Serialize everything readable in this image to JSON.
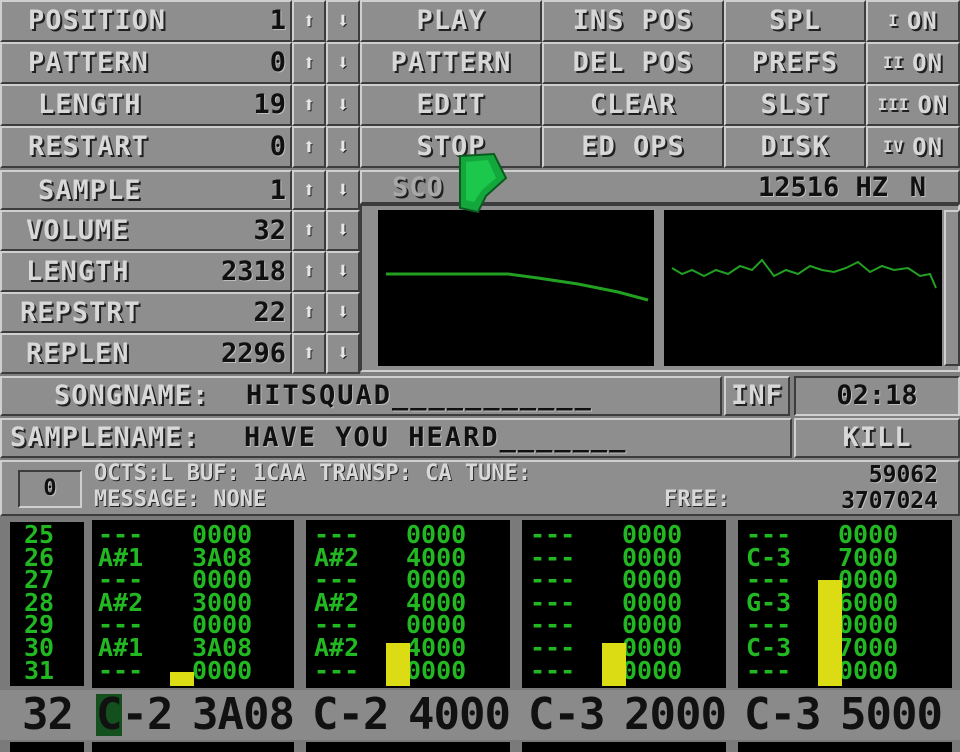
{
  "song_panel": {
    "rows": [
      {
        "label": "POSITION",
        "value": "1"
      },
      {
        "label": "PATTERN",
        "value": "0"
      },
      {
        "label": "LENGTH",
        "value": "19"
      },
      {
        "label": "RESTART",
        "value": "0"
      }
    ]
  },
  "buttons": {
    "play": "PLAY",
    "pattern": "PATTERN",
    "edit": "EDIT",
    "stop": "STOP",
    "ins_pos": "INS POS",
    "del_pos": "DEL POS",
    "clear": "CLEAR",
    "ed_ops": "ED OPS",
    "spl": "SPL",
    "prefs": "PREFS",
    "slst": "SLST",
    "disk": "DISK"
  },
  "channels": [
    {
      "num": "I",
      "state": "ON"
    },
    {
      "num": "II",
      "state": "ON"
    },
    {
      "num": "III",
      "state": "ON"
    },
    {
      "num": "IV",
      "state": "ON"
    }
  ],
  "sample_panel": {
    "sample": {
      "label": "SAMPLE",
      "value": "1"
    },
    "rows": [
      {
        "label": "VOLUME",
        "value": "32"
      },
      {
        "label": "LENGTH",
        "value": "2318"
      },
      {
        "label": "REPSTRT",
        "value": "22"
      },
      {
        "label": "REPLEN",
        "value": "2296"
      }
    ]
  },
  "scope_bar": {
    "label": "SCO",
    "freq": "12516 HZ",
    "mode": "N"
  },
  "songname": {
    "label": "SONGNAME:",
    "value": "HITSQUAD___________"
  },
  "info": {
    "inf": "INF",
    "time": "02:18",
    "kill": "KILL"
  },
  "samplename": {
    "label": "SAMPLENAME:",
    "value": "HAVE YOU HEARD_______"
  },
  "status": {
    "octave_box": "0",
    "line1": "OCTS:L  BUF: 1CAA TRANSP: CA TUNE:",
    "tune_value": "59062",
    "line2": "MESSAGE: NONE",
    "free_label": "FREE:",
    "free_value": "3707024"
  },
  "pattern": {
    "row_numbers": "25\n26\n27\n28\n29\n30\n31",
    "tracks": [
      {
        "notes": "---\nA#1\n---\nA#2\n---\nA#1\n---",
        "params": "0000\n3A08\n0000\n3000\n0000\n3A08\n0000",
        "vu": 0.09
      },
      {
        "notes": "---\nA#2\n---\nA#2\n---\nA#2\n---",
        "params": "0000\n4000\n0000\n4000\n0000\n4000\n0000",
        "vu": 0.27
      },
      {
        "notes": "---\n---\n---\n---\n---\n---\n---",
        "params": "0000\n0000\n0000\n0000\n0000\n0000\n0000",
        "vu": 0.27
      },
      {
        "notes": "---\nC-3\n---\nG-3\n---\nC-3\n---",
        "params": "0000\n7000\n0000\n6000\n0000\n7000\n0000",
        "vu": 0.66
      }
    ],
    "current_row": {
      "num": "32",
      "cells": [
        {
          "note": "C-2",
          "param": "3A08"
        },
        {
          "note": "C-2",
          "param": "4000"
        },
        {
          "note": "C-3",
          "param": "2000"
        },
        {
          "note": "C-3",
          "param": "5000"
        }
      ]
    }
  },
  "colors": {
    "background": "#808080",
    "scope_line": "#22a022",
    "text_green": "#22b822",
    "vu": "#dcdc14",
    "cursor": "#14a83c"
  }
}
